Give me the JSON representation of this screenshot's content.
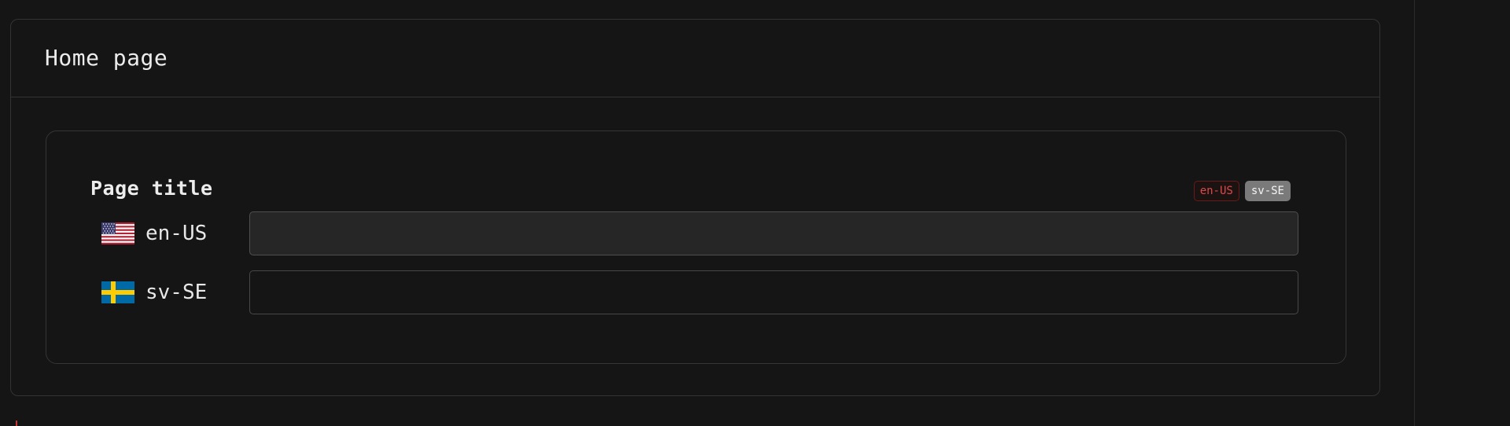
{
  "panel": {
    "title": "Home page"
  },
  "field": {
    "label": "Page title",
    "badges": [
      {
        "label": "en-US",
        "status": "missing",
        "color": "#e04848"
      },
      {
        "label": "sv-SE",
        "status": "filled",
        "color": "#7a7a7a"
      }
    ],
    "locales": [
      {
        "code": "en-US",
        "flag_icon": "us-flag-icon",
        "value": "",
        "placeholder": ""
      },
      {
        "code": "sv-SE",
        "flag_icon": "sweden-flag-icon",
        "value": "",
        "placeholder": ""
      }
    ]
  },
  "colors": {
    "background": "#151515",
    "border": "#333333",
    "error": "#e04848"
  }
}
